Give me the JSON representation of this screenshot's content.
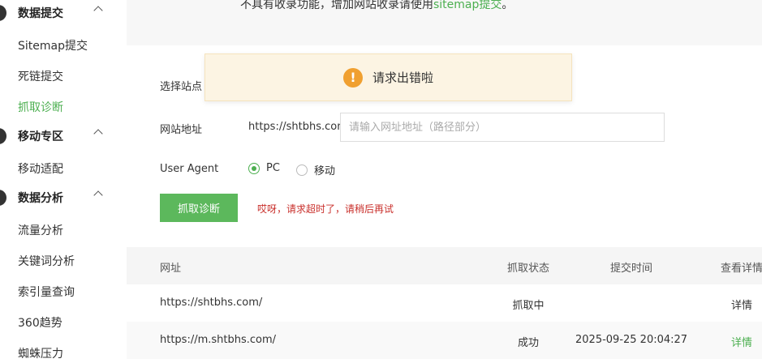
{
  "sidebar": {
    "groups": [
      {
        "label": "数据提交",
        "items": [
          "Sitemap提交",
          "死链提交",
          "抓取诊断"
        ]
      },
      {
        "label": "移动专区",
        "items": [
          "移动适配"
        ]
      },
      {
        "label": "数据分析",
        "items": [
          "流量分析",
          "关键词分析",
          "索引量查询",
          "360趋势",
          "蜘蛛压力"
        ]
      }
    ],
    "active_item": "抓取诊断"
  },
  "top_note": {
    "text": "不具有收录功能，增加网站收录请使用",
    "link": "sitemap提交",
    "suffix": "。"
  },
  "toast": {
    "icon": "!",
    "text": "请求出错啦"
  },
  "form": {
    "site_label": "选择站点",
    "url_label": "网站地址",
    "url_prefix": "https://shtbhs.com/",
    "url_placeholder": "请输入网址地址（路径部分）",
    "ua_label": "User Agent",
    "ua_options": [
      "PC",
      "移动"
    ],
    "ua_selected": "PC",
    "submit_label": "抓取诊断",
    "error_text": "哎呀，请求超时了，请稍后再试"
  },
  "table": {
    "headers": [
      "网址",
      "抓取状态",
      "提交时间",
      "查看详情"
    ],
    "rows": [
      {
        "url": "https://shtbhs.com/",
        "status": "抓取中",
        "time": "",
        "detail": "详情"
      },
      {
        "url": "https://m.shtbhs.com/",
        "status": "成功",
        "time": "2025-09-25 20:04:27",
        "detail": "详情"
      }
    ]
  },
  "colors": {
    "accent_green": "#4caf50",
    "button_green": "#5cb85c",
    "error_red": "#c9302c",
    "toast_bg": "#fcf4e3",
    "toast_icon": "#f0a030"
  }
}
